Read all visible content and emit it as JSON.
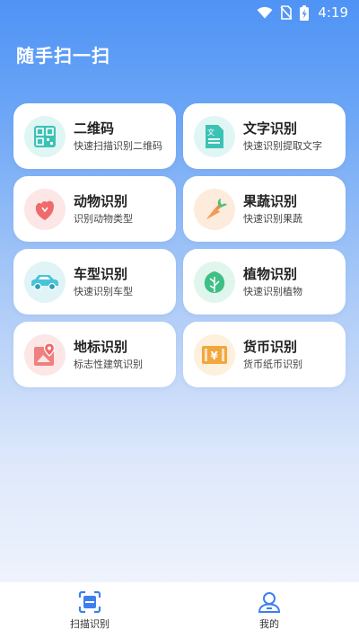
{
  "status": {
    "time": "4:19"
  },
  "app": {
    "title": "随手扫一扫"
  },
  "features": [
    {
      "title": "二维码",
      "subtitle": "快速扫描识别二维码",
      "icon": "qr-code-icon",
      "icon_bg": "#e0f6f4",
      "icon_color": "#3cc2b4"
    },
    {
      "title": "文字识别",
      "subtitle": "快速识别提取文字",
      "icon": "text-document-icon",
      "icon_bg": "#e0f6f4",
      "icon_color": "#3cc2b4"
    },
    {
      "title": "动物识别",
      "subtitle": "识别动物类型",
      "icon": "animal-icon",
      "icon_bg": "#fde6e6",
      "icon_color": "#ef6a6a"
    },
    {
      "title": "果蔬识别",
      "subtitle": "快速识别果蔬",
      "icon": "carrot-icon",
      "icon_bg": "#fdebdc",
      "icon_color": "#f08a48"
    },
    {
      "title": "车型识别",
      "subtitle": "快速识别车型",
      "icon": "car-icon",
      "icon_bg": "#e0f4f7",
      "icon_color": "#48c4d8"
    },
    {
      "title": "植物识别",
      "subtitle": "快速识别植物",
      "icon": "leaf-icon",
      "icon_bg": "#e0f6ec",
      "icon_color": "#3fbf86"
    },
    {
      "title": "地标识别",
      "subtitle": "标志性建筑识别",
      "icon": "landmark-map-icon",
      "icon_bg": "#fde6e6",
      "icon_color": "#ef6a6a"
    },
    {
      "title": "货币识别",
      "subtitle": "货币纸币识别",
      "icon": "banknote-icon",
      "icon_bg": "#fdf0dc",
      "icon_color": "#f3a63c"
    }
  ],
  "nav": {
    "scan_label": "扫描识别",
    "profile_label": "我的",
    "active_color": "#3d7ff0"
  }
}
